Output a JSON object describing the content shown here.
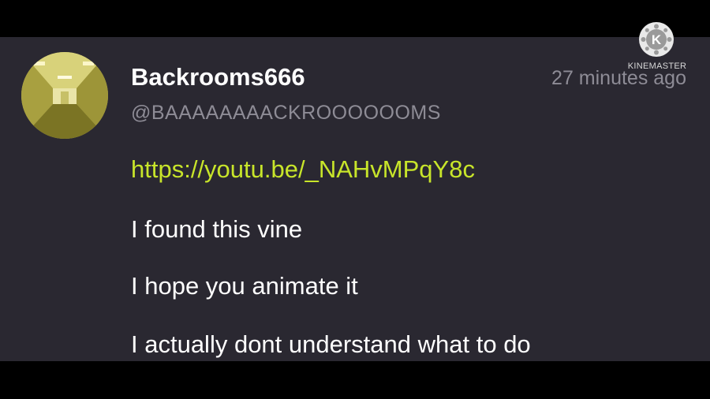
{
  "post": {
    "username": "Backrooms666",
    "handle": "@BAAAAAAAACKROOOOOOMS",
    "timestamp": "27 minutes ago",
    "link": "https://youtu.be/_NAHvMPqY8c",
    "messages": [
      "I found this vine",
      "I hope you animate it",
      "I actually dont understand what to do"
    ]
  },
  "watermark": {
    "brand": "KINEMASTER",
    "letter": "K"
  },
  "colors": {
    "card_background": "#2a2831",
    "letterbox": "#000000",
    "link": "#c8e52a",
    "muted_text": "#8e8c96",
    "primary_text": "#ffffff"
  },
  "icons": {
    "avatar": "backrooms-hallway-avatar",
    "watermark": "kinemaster-logo-icon"
  }
}
